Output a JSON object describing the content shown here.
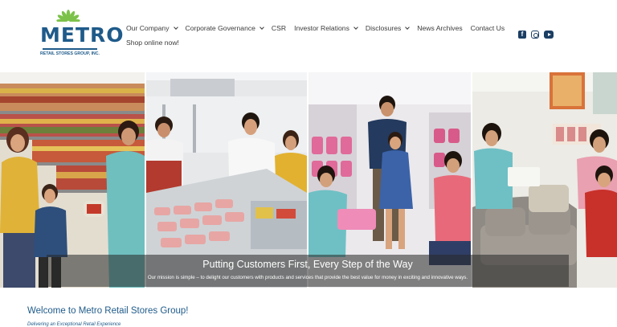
{
  "brand": {
    "wordmark": "METRO",
    "subline": "RETAIL STORES GROUP, INC.",
    "colors": {
      "primary": "#1f5b8a",
      "fan_green": "#7cc24a",
      "social": "#1b3e63"
    }
  },
  "nav": {
    "row1": [
      {
        "label": "Our Company",
        "dropdown": true
      },
      {
        "label": "Corporate Governance",
        "dropdown": true
      },
      {
        "label": "CSR",
        "dropdown": false
      },
      {
        "label": "Investor Relations",
        "dropdown": true
      },
      {
        "label": "Disclosures",
        "dropdown": true
      },
      {
        "label": "News Archives",
        "dropdown": false
      },
      {
        "label": "Contact Us",
        "dropdown": false
      }
    ],
    "row2": [
      {
        "label": "Shop online now!",
        "dropdown": false
      }
    ]
  },
  "social": [
    {
      "icon": "facebook-icon",
      "glyph": "f"
    },
    {
      "icon": "instagram-icon",
      "glyph": ""
    },
    {
      "icon": "youtube-icon",
      "glyph": ""
    }
  ],
  "hero": {
    "panels": [
      "grocery-aisle-photo",
      "meat-counter-photo",
      "kids-shoes-photo",
      "home-furniture-photo"
    ],
    "title": "Putting Customers First, Every Step of the Way",
    "subtitle": "Our mission is simple – to delight our customers with products and services that provide the best value for money in exciting and innovative ways."
  },
  "intro": {
    "heading": "Welcome to Metro Retail Stores Group!",
    "tagline": "Delivering an Exceptional Retail Experience"
  }
}
